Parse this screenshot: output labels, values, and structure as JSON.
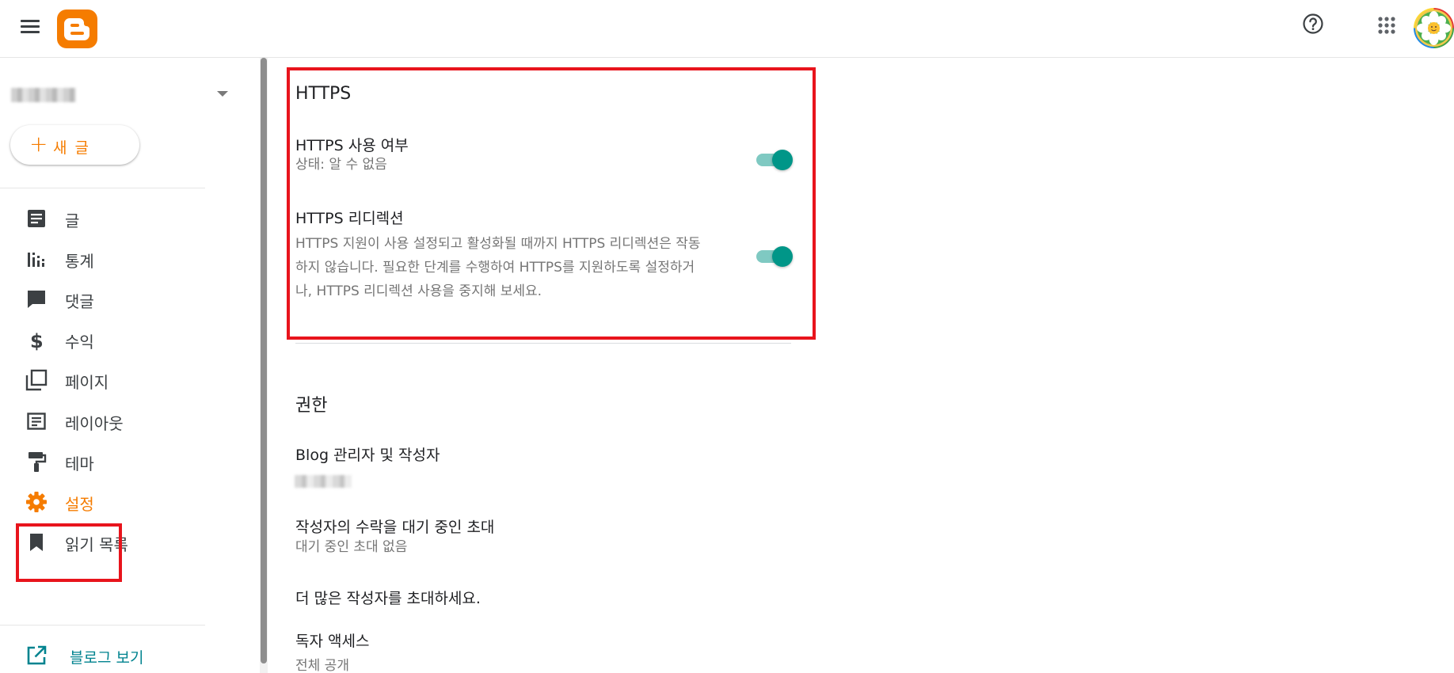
{
  "topbar": {
    "menu_icon": "hamburger-menu-icon",
    "logo_icon": "blogger-logo-icon",
    "help_icon": "help-circle-icon",
    "apps_icon": "apps-grid-icon",
    "avatar_icon": "flower-avatar"
  },
  "sidebar": {
    "new_post_label": "새 글",
    "items": [
      {
        "label": "글",
        "icon": "posts-icon"
      },
      {
        "label": "통계",
        "icon": "stats-icon"
      },
      {
        "label": "댓글",
        "icon": "comments-icon"
      },
      {
        "label": "수익",
        "icon": "dollar-icon"
      },
      {
        "label": "페이지",
        "icon": "pages-icon"
      },
      {
        "label": "레이아웃",
        "icon": "layout-icon"
      },
      {
        "label": "테마",
        "icon": "paint-roller-icon"
      },
      {
        "label": "설정",
        "icon": "gear-icon",
        "active": true
      },
      {
        "label": "읽기 목록",
        "icon": "bookmark-icon"
      }
    ],
    "view_blog_label": "블로그 보기"
  },
  "https": {
    "title": "HTTPS",
    "enable_title": "HTTPS 사용 여부",
    "enable_status": "상태: 알 수 없음",
    "enable_on": true,
    "redirect_title": "HTTPS 리디렉션",
    "redirect_desc_1": "HTTPS 지원이 사용 설정되고 활성화될 때까지 HTTPS 리디렉션은 작동",
    "redirect_desc_2": "하지 않습니다. 필요한 단계를 수행하여 HTTPS를 지원하도록 설정하거",
    "redirect_desc_3": "나, HTTPS 리디렉션 사용을 중지해 보세요.",
    "redirect_on": true
  },
  "permissions": {
    "title": "권한",
    "admins_title": "Blog 관리자 및 작성자",
    "pending_title": "작성자의 수락을 대기 중인 초대",
    "pending_status": "대기 중인 초대 없음",
    "invite_more": "더 많은 작성자를 초대하세요.",
    "reader_access_title": "독자 액세스",
    "reader_access_value": "전체 공개"
  },
  "colors": {
    "accent": "#f57c00",
    "teal": "#009688",
    "highlight": "#e8141c",
    "link": "#00838f"
  }
}
